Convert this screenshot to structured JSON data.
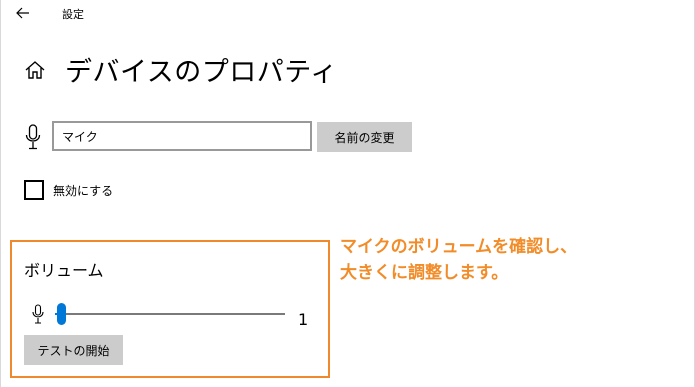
{
  "window": {
    "title": "設定",
    "back_icon": "arrow-left-icon"
  },
  "header": {
    "home_icon": "home-icon",
    "title": "デバイスのプロパティ"
  },
  "device_name": {
    "mic_icon": "microphone-icon",
    "value": "マイク",
    "rename_label": "名前の変更"
  },
  "disable": {
    "label": "無効にする",
    "checked": false
  },
  "volume": {
    "heading": "ボリューム",
    "mic_icon": "microphone-icon",
    "level": 1,
    "max": 100,
    "value_label": "1",
    "test_label": "テストの開始"
  },
  "annotation": {
    "line1": "マイクのボリュームを確認し、",
    "line2": "大きくに調整します。",
    "color": "#f28c28",
    "box_color": "#f0892b"
  },
  "colors": {
    "accent": "#0078d7",
    "button_bg": "#cccccc"
  }
}
